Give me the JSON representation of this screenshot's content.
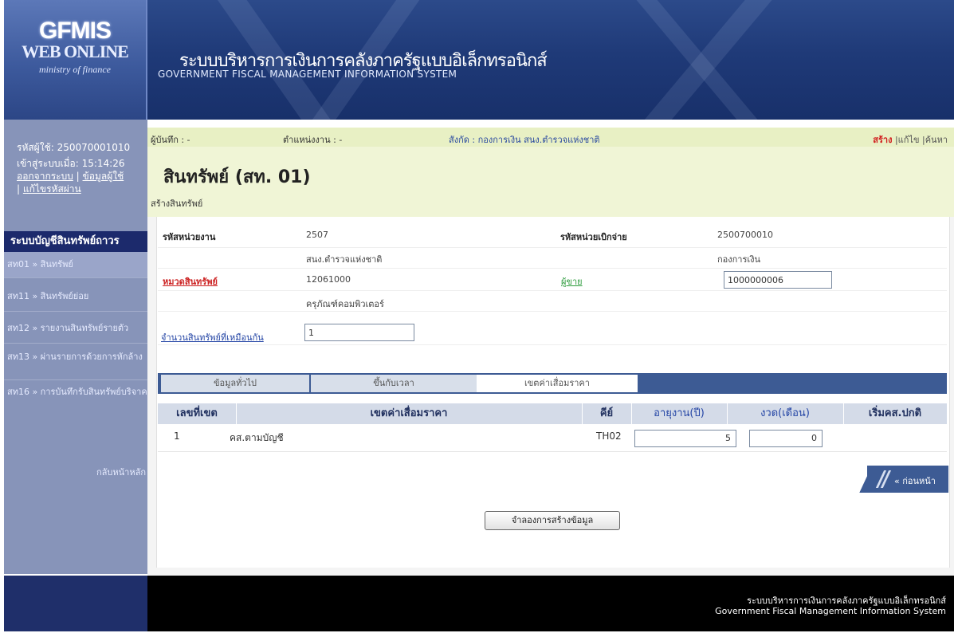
{
  "header": {
    "logo_main": "GFMIS",
    "logo_sub": "WEB ONLINE",
    "logo_ministry": "ministry of finance",
    "title_th": "ระบบบริหารการเงินการคลังภาครัฐแบบอิเล็กทรอนิกส์",
    "title_en": "GOVERNMENT FISCAL MANAGEMENT INFORMATION SYSTEM"
  },
  "sidebar": {
    "user_code_label": "รหัสผู้ใช้: 250070001010",
    "login_time_label": "เข้าสู่ระบบเมื่อ: 15:14:26",
    "link_logout": "ออกจากระบบ",
    "link_userinfo": "ข้อมูลผู้ใช้",
    "link_changepw": "แก้ไขรหัสผ่าน",
    "menu_title": "ระบบบัญชีสินทรัพย์ถาวร",
    "items": [
      {
        "label": "สท01 » สินทรัพย์"
      },
      {
        "label": "สท11 » สินทรัพย์ย่อย"
      },
      {
        "label": "สท12 » รายงานสินทรัพย์รายตัว"
      },
      {
        "label": "สท13 » ผ่านรายการด้วยการหักล้าง"
      },
      {
        "label": "สท16 » การบันทึกรับสินทรัพย์บริจาค"
      }
    ],
    "home_link": "กลับหน้าหลัก"
  },
  "infobar": {
    "recorder": "ผู้บันทึก : -",
    "position": "ตำแหน่งงาน : -",
    "affiliation": "สังกัด : กองการเงิน สนง.ตำรวจแห่งชาติ",
    "action_create": "สร้าง",
    "action_edit": "แก้ไข",
    "action_search": "ค้นหา"
  },
  "page": {
    "title": "สินทรัพย์ (สท. 01)",
    "subtitle": "สร้างสินทรัพย์"
  },
  "form": {
    "agency_code_label": "รหัสหน่วยงาน",
    "agency_code": "2507",
    "agency_name": "สนง.ตำรวจแห่งชาติ",
    "disb_code_label": "รหัสหน่วยเบิกจ่าย",
    "disb_code": "2500700010",
    "disb_name": "กองการเงิน",
    "asset_class_label": "หมวดสินทรัพย์",
    "asset_class": "12061000",
    "asset_class_name": "ครุภัณฑ์คอมพิวเตอร์",
    "vendor_label": "ผู้ขาย",
    "vendor_value": "1000000006",
    "qty_label": "จำนวนสินทรัพย์ที่เหมือนกัน",
    "qty_value": "1"
  },
  "tabs": [
    {
      "label": "ข้อมูลทั่วไป"
    },
    {
      "label": "ขึ้นกับเวลา"
    },
    {
      "label": "เขตค่าเสื่อมราคา"
    }
  ],
  "table": {
    "headers": [
      "เลขที่เขต",
      "เขตค่าเสื่อมราคา",
      "คีย์",
      "อายุงาน(ปี)",
      "งวด(เดือน)",
      "เริ่มคส.ปกติ"
    ],
    "rows": [
      {
        "no": "1",
        "area": "คส.ตามบัญชี",
        "key": "TH02",
        "years": "5",
        "months": "0",
        "start": ""
      }
    ]
  },
  "buttons": {
    "prev": "« ก่อนหน้า",
    "simulate": "จำลองการสร้างข้อมูล"
  },
  "footer": {
    "th": "ระบบบริหารการเงินการคลังภาครัฐแบบอิเล็กทรอนิกส์",
    "en": "Government Fiscal Management Information System"
  }
}
